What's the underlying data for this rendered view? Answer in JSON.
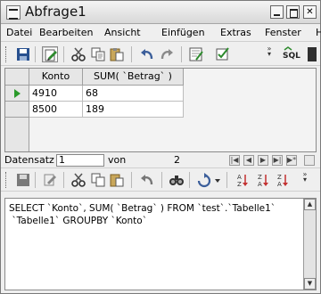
{
  "window": {
    "title": "Abfrage1"
  },
  "menu": {
    "items": [
      {
        "label": "Datei"
      },
      {
        "label": "Bearbeiten"
      },
      {
        "label": "Ansicht"
      },
      {
        "label": "Einfügen"
      },
      {
        "label": "Extras"
      },
      {
        "label": "Fenster"
      },
      {
        "label": "H"
      }
    ]
  },
  "toolbar": {
    "sql_label": "SQL"
  },
  "grid": {
    "columns": [
      "Konto",
      "SUM( `Betrag` )"
    ],
    "rows": [
      [
        "4910",
        "68"
      ],
      [
        "8500",
        "189"
      ]
    ]
  },
  "record_nav": {
    "label": "Datensatz",
    "current": "1",
    "of_label": "von",
    "total": "2"
  },
  "sql": {
    "text": "SELECT `Konto`, SUM( `Betrag` ) FROM `test`.`Tabelle1`\n `Tabelle1` GROUPBY `Konto`"
  },
  "icons": {
    "save": "save-icon",
    "edit": "edit-mode-icon",
    "cut": "cut-icon",
    "copy": "copy-icon",
    "paste": "paste-icon",
    "undo": "undo-icon",
    "redo": "redo-icon",
    "run": "run-query-icon",
    "sort_asc": "sort-ascending-icon",
    "sort_desc": "sort-descending-icon",
    "filter": "autofilter-icon",
    "find": "find-icon"
  },
  "colors": {
    "current_row_marker": "#2b9a2b",
    "save_icon": "#27508f",
    "undo_icon": "#3b5e9a",
    "sort_icon": "#c33030"
  }
}
